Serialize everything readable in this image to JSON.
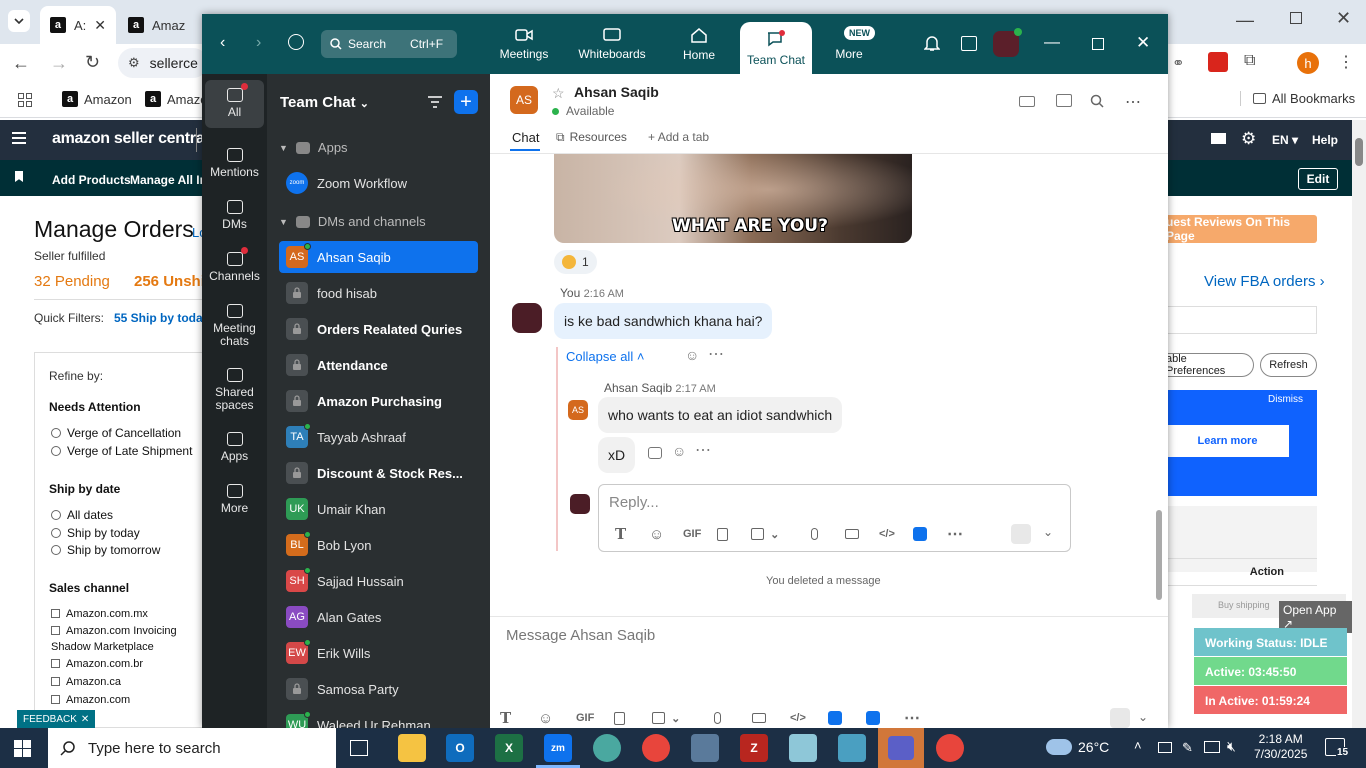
{
  "browser": {
    "tabs": [
      {
        "label": "A:",
        "favicon": "a"
      },
      {
        "label": "Amaz",
        "favicon": "a"
      }
    ],
    "address": "sellerce",
    "bookmarks": [
      "Amazon",
      "Amazo"
    ],
    "all_bookmarks": "All Bookmarks",
    "profile_initial": "h"
  },
  "seller_central": {
    "logo": "amazon seller central",
    "header_lang": "EN",
    "header_help": "Help",
    "nav": [
      "Add Products",
      "Manage All Inve"
    ],
    "edit": "Edit",
    "page_title": "Manage Orders",
    "title_suffix": "Lo",
    "subtitle": "Seller fulfilled",
    "pending": "32 Pending",
    "unshipped": "256 Unshi",
    "quick_filters_label": "Quick Filters:",
    "quick_filter_1": "55 Ship by today",
    "refine_by": "Refine by:",
    "needs_attention": "Needs Attention",
    "needs_attention_items": [
      "Verge of Cancellation",
      "Verge of Late Shipment"
    ],
    "ship_by_date": "Ship by date",
    "ship_by_items": [
      "All dates",
      "Ship by today",
      "Ship by tomorrow"
    ],
    "sales_channel": "Sales channel",
    "sales_channel_items": [
      "Amazon.com.mx",
      "Amazon.com Invoicing",
      "Shadow Marketplace",
      "Amazon.com.br",
      "Amazon.ca",
      "Amazon.com"
    ],
    "feedback": "FEEDBACK",
    "reviews_btn": "uest Reviews On This Page",
    "view_fba": "View FBA orders",
    "preferences_btn": "able Preferences",
    "refresh_btn": "Refresh",
    "dismiss": "Dismiss",
    "learn_more": "Learn more",
    "action_col": "Action",
    "buy_shipping": "Buy shipping",
    "open_app": "Open App",
    "working_status": "Working Status: IDLE",
    "active_time": "Active: 03:45:50",
    "inactive_time": "In Active: 01:59:24"
  },
  "zoom": {
    "search_label": "Search",
    "search_shortcut": "Ctrl+F",
    "tabs": [
      {
        "label": "Meetings",
        "icon": "video-icon"
      },
      {
        "label": "Whiteboards",
        "icon": "whiteboard-icon"
      },
      {
        "label": "Home",
        "icon": "home-icon"
      },
      {
        "label": "Team Chat",
        "icon": "chat-icon"
      },
      {
        "label": "More",
        "icon": "more-icon",
        "badge": "NEW"
      }
    ],
    "rail": [
      {
        "label": "All",
        "icon": "chat-bubble-icon"
      },
      {
        "label": "Mentions",
        "icon": "at-icon"
      },
      {
        "label": "DMs",
        "icon": "people-icon"
      },
      {
        "label": "Channels",
        "icon": "hash-icon"
      },
      {
        "label": "Meeting chats",
        "icon": "calendar-icon"
      },
      {
        "label": "Shared spaces",
        "icon": "share-icon"
      },
      {
        "label": "Apps",
        "icon": "apps-icon"
      },
      {
        "label": "More",
        "icon": "ellipsis-icon"
      }
    ],
    "list_title": "Team Chat",
    "section_apps": "Apps",
    "section_dms": "DMs and channels",
    "apps": [
      {
        "name": "Zoom Workflow",
        "badge": "zoom"
      }
    ],
    "conversations": [
      {
        "name": "Ahsan Saqib",
        "type": "user",
        "initials": "AS",
        "color": "#d4691d",
        "online": true,
        "selected": true,
        "bold": false
      },
      {
        "name": "food hisab",
        "type": "lock",
        "bold": false
      },
      {
        "name": "Orders Realated Quries",
        "type": "lock",
        "bold": true
      },
      {
        "name": "Attendance",
        "type": "lock",
        "bold": true
      },
      {
        "name": "Amazon Purchasing",
        "type": "lock",
        "bold": true
      },
      {
        "name": "Tayyab Ashraaf",
        "type": "user",
        "initials": "TA",
        "color": "#2e7fb8",
        "online": true,
        "bold": false
      },
      {
        "name": "Discount & Stock Res...",
        "type": "lock",
        "bold": true
      },
      {
        "name": "Umair Khan",
        "type": "user",
        "initials": "UK",
        "color": "#2e9b55",
        "online": false,
        "bold": false
      },
      {
        "name": "Bob Lyon",
        "type": "user",
        "initials": "BL",
        "color": "#d46c1c",
        "online": true,
        "bold": false
      },
      {
        "name": "Sajjad Hussain",
        "type": "user",
        "initials": "SH",
        "color": "#d94848",
        "online": true,
        "bold": false
      },
      {
        "name": "Alan Gates",
        "type": "user",
        "initials": "AG",
        "color": "#8a4bc2",
        "online": false,
        "bold": false
      },
      {
        "name": "Erik Wills",
        "type": "user",
        "initials": "EW",
        "color": "#d44848",
        "online": true,
        "bold": false
      },
      {
        "name": "Samosa Party",
        "type": "lock",
        "bold": false
      },
      {
        "name": "Waleed Ur Rehman",
        "type": "user",
        "initials": "WU",
        "color": "#2e9b55",
        "online": true,
        "bold": false
      }
    ],
    "chat": {
      "contact_name": "Ahsan Saqib",
      "contact_initials": "AS",
      "status": "Available",
      "tab_chat": "Chat",
      "tab_resources": "Resources",
      "tab_add": "Add a tab",
      "meme_caption": "WHAT ARE YOU?",
      "reaction_count": "1",
      "my_name": "You",
      "my_time": "2:16 AM",
      "my_message": "is ke bad sandwhich khana hai?",
      "collapse_all": "Collapse all",
      "reply_name": "Ahsan Saqib",
      "reply_time": "2:17 AM",
      "reply_message_1": "who wants to eat an idiot sandwhich",
      "reply_message_2": "xD",
      "reply_placeholder": "Reply...",
      "deleted_notice": "You deleted a message",
      "message_placeholder": "Message Ahsan Saqib",
      "gif": "GIF"
    }
  },
  "taskbar": {
    "search_placeholder": "Type here to search",
    "temperature": "26°C",
    "time": "2:18 AM",
    "date": "7/30/2025",
    "notification_count": "15"
  }
}
